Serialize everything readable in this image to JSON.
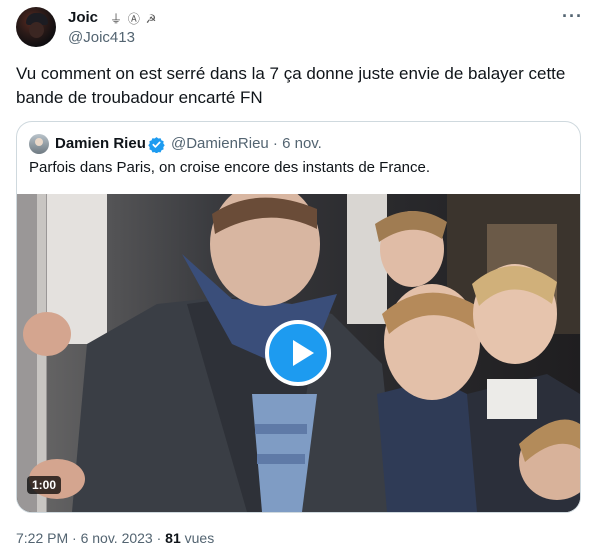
{
  "tweet": {
    "author_name": "Joic",
    "author_emoji": "⏚ Ⓐ ☭",
    "author_handle": "@Joic413",
    "text": "Vu comment on est serré dans la 7 ça donne juste envie de balayer cette bande de troubadour encarté FN",
    "timestamp": "7:22 PM · 6 nov. 2023 · ",
    "views_count": "81",
    "views_label": " vues"
  },
  "quote": {
    "author_name": "Damien Rieu",
    "author_handle": "@DamienRieu · 6 nov.",
    "text": "Parfois dans Paris, on croise encore des instants de France.",
    "video_duration": "1:00"
  },
  "colors": {
    "accent": "#1d9bf0",
    "secondary_text": "#536471",
    "border": "#cfd9de"
  },
  "icons": {
    "more": "more-icon",
    "verified": "verified-badge-icon",
    "play": "play-icon"
  }
}
